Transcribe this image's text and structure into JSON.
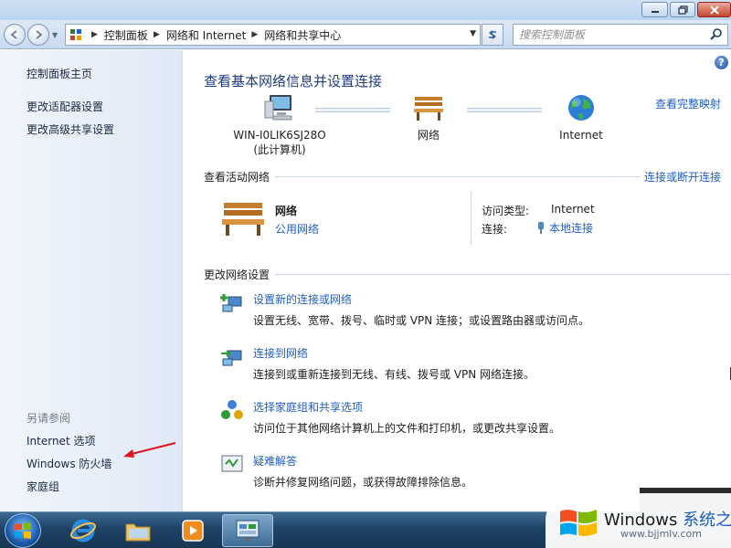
{
  "navbar": {
    "breadcrumbs": [
      "控制面板",
      "网络和 Internet",
      "网络和共享中心"
    ],
    "search_placeholder": "搜索控制面板"
  },
  "sidebar": {
    "items": [
      "控制面板主页",
      "更改适配器设置",
      "更改高级共享设置"
    ],
    "see_also_label": "另请参阅",
    "see_also_items": [
      "Internet 选项",
      "Windows 防火墙",
      "家庭组"
    ]
  },
  "main": {
    "title": "查看基本网络信息并设置连接",
    "view_full_map": "查看完整映射",
    "network_map": {
      "computer_name": "WIN-I0LIK6SJ28O",
      "computer_sub": "(此计算机)",
      "network": "网络",
      "internet": "Internet"
    },
    "active_networks": {
      "header": "查看活动网络",
      "connect_disconnect": "连接或断开连接",
      "network_name": "网络",
      "network_type": "公用网络",
      "access_type_label": "访问类型:",
      "access_type_value": "Internet",
      "connections_label": "连接:",
      "connections_value": "本地连接"
    },
    "change_settings": {
      "header": "更改网络设置",
      "tasks": [
        {
          "title": "设置新的连接或网络",
          "desc": "设置无线、宽带、拨号、临时或 VPN 连接；或设置路由器或访问点。"
        },
        {
          "title": "连接到网络",
          "desc": "连接到或重新连接到无线、有线、拨号或 VPN 网络连接。"
        },
        {
          "title": "选择家庭组和共享选项",
          "desc": "访问位于其他网络计算机上的文件和打印机，或更改共享设置。"
        },
        {
          "title": "疑难解答",
          "desc": "诊断并修复网络问题，或获得故障排除信息。"
        }
      ]
    }
  },
  "watermark": {
    "title": "Windows",
    "title_cn": "系统之家",
    "url": "www.bjjmlv.com"
  },
  "colors": {
    "link": "#1f5ec7",
    "title": "#1e3b82",
    "sidebar_bg": "#e4edf8",
    "taskbar": "#1e4266"
  }
}
